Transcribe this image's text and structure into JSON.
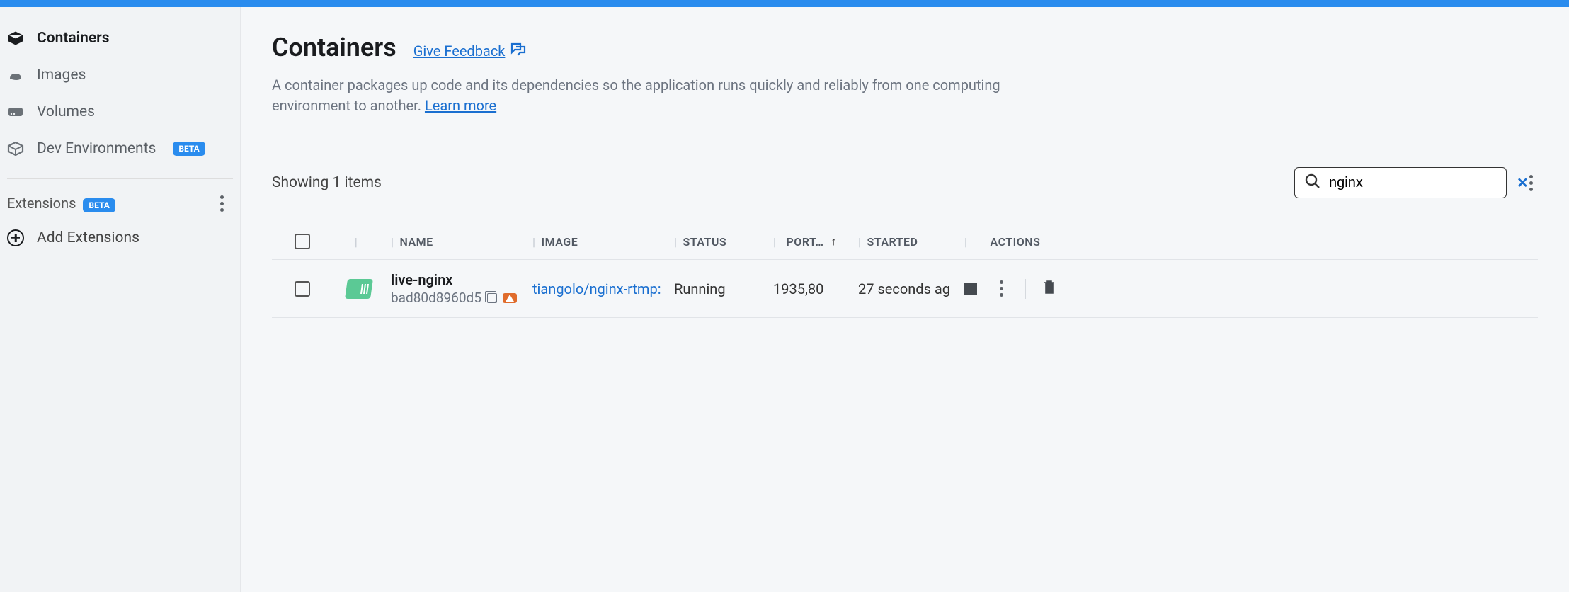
{
  "sidebar": {
    "items": [
      {
        "label": "Containers",
        "active": true
      },
      {
        "label": "Images"
      },
      {
        "label": "Volumes"
      },
      {
        "label": "Dev Environments",
        "badge": "BETA"
      }
    ],
    "extensions_label": "Extensions",
    "extensions_badge": "BETA",
    "add_extensions_label": "Add Extensions"
  },
  "page": {
    "title": "Containers",
    "feedback_label": "Give Feedback",
    "description": "A container packages up code and its dependencies so the application runs quickly and reliably from one computing environment to another. ",
    "learn_more": "Learn more"
  },
  "list": {
    "showing_text": "Showing 1 items",
    "search_value": "nginx"
  },
  "table": {
    "headers": {
      "name": "NAME",
      "image": "IMAGE",
      "status": "STATUS",
      "ports": "PORT…",
      "started": "STARTED",
      "actions": "ACTIONS"
    },
    "row": {
      "name": "live-nginx",
      "id": "bad80d8960d5",
      "image": "tiangolo/nginx-rtmp:",
      "status": "Running",
      "ports": "1935,80",
      "started": "27 seconds ag"
    }
  }
}
